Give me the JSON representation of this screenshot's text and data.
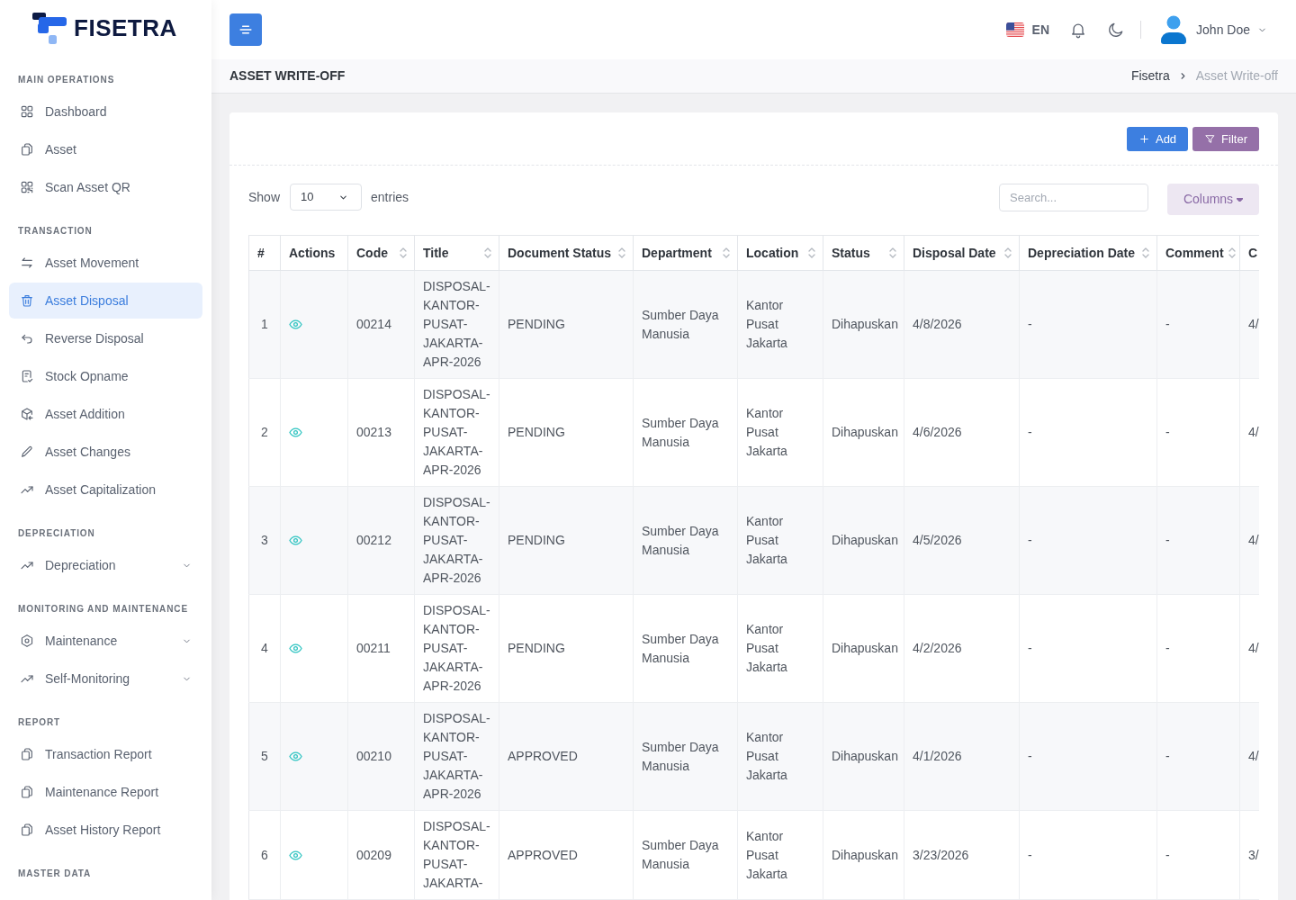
{
  "brand": {
    "name": "FISETRA"
  },
  "sidebar": {
    "sections": [
      {
        "label": "MAIN OPERATIONS",
        "items": [
          {
            "label": "Dashboard",
            "selected": false
          },
          {
            "label": "Asset",
            "selected": false
          },
          {
            "label": "Scan Asset QR",
            "selected": false
          }
        ]
      },
      {
        "label": "TRANSACTION",
        "items": [
          {
            "label": "Asset Movement",
            "selected": false
          },
          {
            "label": "Asset Disposal",
            "selected": true
          },
          {
            "label": "Reverse Disposal",
            "selected": false
          },
          {
            "label": "Stock Opname",
            "selected": false
          },
          {
            "label": "Asset Addition",
            "selected": false
          },
          {
            "label": "Asset Changes",
            "selected": false
          },
          {
            "label": "Asset Capitalization",
            "selected": false
          }
        ]
      },
      {
        "label": "DEPRECIATION",
        "items": [
          {
            "label": "Depreciation",
            "selected": false,
            "expanded": false
          }
        ]
      },
      {
        "label": "MONITORING AND MAINTENANCE",
        "items": [
          {
            "label": "Maintenance",
            "selected": false,
            "expanded": false
          },
          {
            "label": "Self-Monitoring",
            "selected": false,
            "expanded": false
          }
        ]
      },
      {
        "label": "REPORT",
        "items": [
          {
            "label": "Transaction Report",
            "selected": false
          },
          {
            "label": "Maintenance Report",
            "selected": false
          },
          {
            "label": "Asset History Report",
            "selected": false
          }
        ]
      },
      {
        "label": "MASTER DATA"
      }
    ]
  },
  "topbar": {
    "language": {
      "code": "EN"
    },
    "user": {
      "name": "John Doe"
    }
  },
  "page_header": {
    "title": "ASSET WRITE-OFF",
    "breadcrumb": [
      {
        "label": "Fisetra",
        "current": false
      },
      {
        "label": "Asset Write-off",
        "current": true
      }
    ]
  },
  "card": {
    "buttons": [
      {
        "label": "Add",
        "kind": "add"
      },
      {
        "label": "Filter",
        "kind": "filter"
      }
    ],
    "length_menu": {
      "prefix": "Show",
      "value": "10",
      "suffix": "entries"
    },
    "search": {
      "placeholder": "Search..."
    },
    "columns_button": {
      "label": "Columns"
    },
    "table": {
      "columns": [
        {
          "label": "#",
          "kind": "index",
          "sortable": false
        },
        {
          "label": "Actions",
          "kind": "actions",
          "sortable": false
        },
        {
          "label": "Code",
          "kind": "text",
          "sortable": true
        },
        {
          "label": "Title",
          "kind": "text",
          "sortable": true
        },
        {
          "label": "Document Status",
          "kind": "text",
          "sortable": true
        },
        {
          "label": "Department",
          "kind": "text",
          "sortable": true
        },
        {
          "label": "Location",
          "kind": "text",
          "sortable": true
        },
        {
          "label": "Status",
          "kind": "text",
          "sortable": true
        },
        {
          "label": "Disposal Date",
          "kind": "text",
          "sortable": true
        },
        {
          "label": "Depreciation Date",
          "kind": "text",
          "sortable": true
        },
        {
          "label": "Comment",
          "kind": "text",
          "sortable": true
        },
        {
          "label": "C",
          "kind": "text"
        }
      ],
      "rows": [
        [
          "1",
          "",
          "00214",
          "DISPOSAL-KANTOR-PUSAT-JAKARTA-APR-2026",
          "PENDING",
          "Sumber Daya Manusia",
          "Kantor Pusat Jakarta",
          "Dihapuskan",
          "4/8/2026",
          "-",
          "-",
          "4/"
        ],
        [
          "2",
          "",
          "00213",
          "DISPOSAL-KANTOR-PUSAT-JAKARTA-APR-2026",
          "PENDING",
          "Sumber Daya Manusia",
          "Kantor Pusat Jakarta",
          "Dihapuskan",
          "4/6/2026",
          "-",
          "-",
          "4/"
        ],
        [
          "3",
          "",
          "00212",
          "DISPOSAL-KANTOR-PUSAT-JAKARTA-APR-2026",
          "PENDING",
          "Sumber Daya Manusia",
          "Kantor Pusat Jakarta",
          "Dihapuskan",
          "4/5/2026",
          "-",
          "-",
          "4/"
        ],
        [
          "4",
          "",
          "00211",
          "DISPOSAL-KANTOR-PUSAT-JAKARTA-APR-2026",
          "PENDING",
          "Sumber Daya Manusia",
          "Kantor Pusat Jakarta",
          "Dihapuskan",
          "4/2/2026",
          "-",
          "-",
          "4/"
        ],
        [
          "5",
          "",
          "00210",
          "DISPOSAL-KANTOR-PUSAT-JAKARTA-APR-2026",
          "APPROVED",
          "Sumber Daya Manusia",
          "Kantor Pusat Jakarta",
          "Dihapuskan",
          "4/1/2026",
          "-",
          "-",
          "4/"
        ],
        [
          "6",
          "",
          "00209",
          "DISPOSAL-KANTOR-PUSAT-JAKARTA-",
          "APPROVED",
          "Sumber Daya Manusia",
          "Kantor Pusat Jakarta",
          "Dihapuskan",
          "3/23/2026",
          "-",
          "-",
          "3/"
        ]
      ]
    }
  }
}
